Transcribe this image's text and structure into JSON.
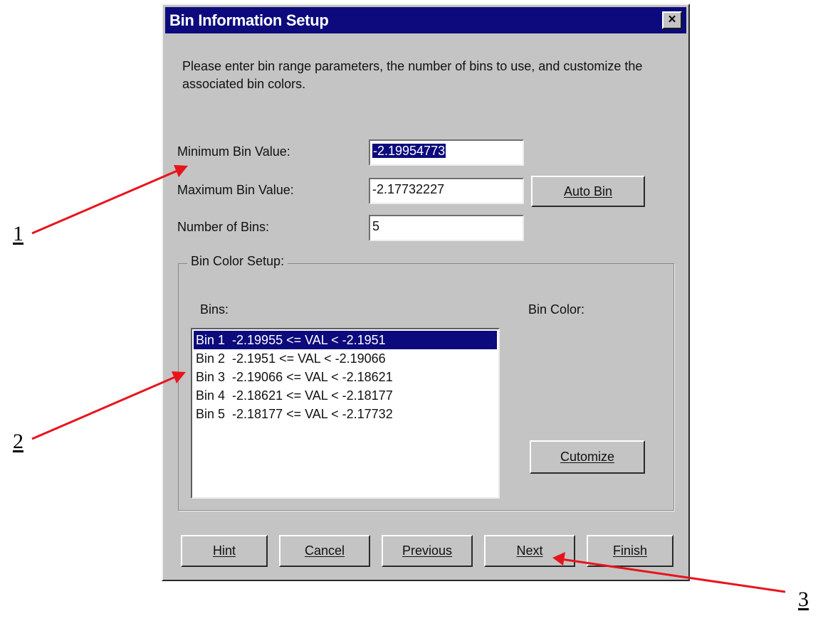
{
  "dialog": {
    "title": "Bin Information Setup",
    "close_glyph": "×",
    "instructions": "Please enter bin range parameters, the number of bins to use, and customize the associated bin colors."
  },
  "fields": {
    "min_label": "Minimum Bin Value:",
    "min_value": "-2.19954773",
    "max_label": "Maximum Bin Value:",
    "max_value": "-2.17732227",
    "num_label": "Number of Bins:",
    "num_value": "5",
    "auto_bin_label": "Auto Bin"
  },
  "color_setup": {
    "group_title": "Bin Color Setup:",
    "bins_label": "Bins:",
    "bin_color_label": "Bin Color:",
    "customize_label": "Cutomize",
    "selected_index": 0,
    "bins": [
      "Bin 1  -2.19955 <= VAL < -2.1951",
      "Bin 2  -2.1951 <= VAL < -2.19066",
      "Bin 3  -2.19066 <= VAL < -2.18621",
      "Bin 4  -2.18621 <= VAL < -2.18177",
      "Bin 5  -2.18177 <= VAL < -2.17732"
    ]
  },
  "buttons": {
    "hint": "Hint",
    "cancel": "Cancel",
    "previous": "Previous",
    "next": "Next",
    "finish": "Finish"
  },
  "annotations": {
    "one": "1",
    "two": "2",
    "three": "3",
    "arrow_color": "#e8141c"
  },
  "colors": {
    "title_bar": "#0c0a7c",
    "dialog_face": "#c4c4c4",
    "selection": "#0c0a7c"
  }
}
